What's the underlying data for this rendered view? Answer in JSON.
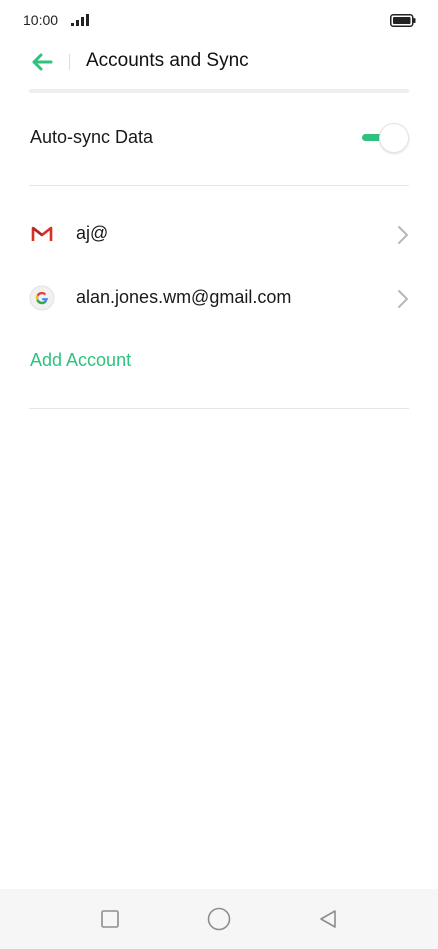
{
  "status_bar": {
    "time": "10:00",
    "signal_icon": "signal-bars-icon",
    "battery_icon": "battery-icon"
  },
  "header": {
    "back_icon": "arrow-left-icon",
    "title": "Accounts and Sync"
  },
  "auto_sync": {
    "label": "Auto-sync Data",
    "enabled": true
  },
  "accounts": [
    {
      "icon": "gmail-icon",
      "label": "aj@"
    },
    {
      "icon": "google-icon",
      "label": "alan.jones.wm@gmail.com"
    }
  ],
  "add_account_label": "Add Account",
  "navigation": {
    "recents_icon": "square-icon",
    "home_icon": "circle-icon",
    "back_icon": "triangle-back-icon"
  },
  "colors": {
    "accent": "#2ec27e",
    "divider": "#e6e6e6",
    "nav_background": "#f6f6f6"
  }
}
